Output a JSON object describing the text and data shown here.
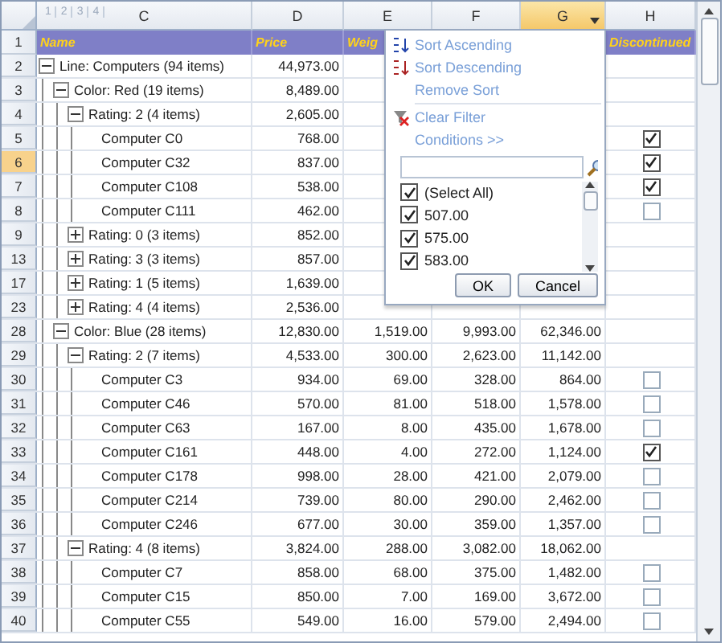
{
  "outline_levels": [
    "1",
    "2",
    "3",
    "4"
  ],
  "columns": [
    {
      "letter": "C",
      "selected": false
    },
    {
      "letter": "D",
      "selected": false
    },
    {
      "letter": "E",
      "selected": false
    },
    {
      "letter": "F",
      "selected": false
    },
    {
      "letter": "G",
      "selected": true
    },
    {
      "letter": "H",
      "selected": false
    }
  ],
  "header_row": {
    "number": "1",
    "name": "Name",
    "price": "Price",
    "weight": "Weig",
    "discontinued": "Discontinued"
  },
  "rows": [
    {
      "number": "2",
      "name": "Line: Computers (94 items)",
      "expanded": true,
      "selected": false,
      "price": "44,973.00",
      "children": [
        {
          "number": "3",
          "name": "Color: Red (19 items)",
          "expanded": true,
          "selected": false,
          "price": "8,489.00",
          "children": [
            {
              "number": "4",
              "name": "Rating: 2 (4 items)",
              "expanded": true,
              "selected": false,
              "price": "2,605.00",
              "children": [
                {
                  "number": "5",
                  "name": "Computer C0",
                  "selected": false,
                  "price": "768.00",
                  "discontinued": true
                },
                {
                  "number": "6",
                  "name": "Computer C32",
                  "selected": true,
                  "price": "837.00",
                  "discontinued": true
                },
                {
                  "number": "7",
                  "name": "Computer C108",
                  "selected": false,
                  "price": "538.00",
                  "discontinued": true
                },
                {
                  "number": "8",
                  "name": "Computer C111",
                  "selected": false,
                  "price": "462.00",
                  "discontinued": false
                }
              ]
            },
            {
              "number": "9",
              "name": "Rating: 0 (3 items)",
              "expanded": false,
              "selected": false,
              "price": "852.00"
            },
            {
              "number": "13",
              "name": "Rating: 3 (3 items)",
              "expanded": false,
              "selected": false,
              "price": "857.00"
            },
            {
              "number": "17",
              "name": "Rating: 1 (5 items)",
              "expanded": false,
              "selected": false,
              "price": "1,639.00"
            },
            {
              "number": "23",
              "name": "Rating: 4 (4 items)",
              "expanded": false,
              "selected": false,
              "price": "2,536.00"
            }
          ]
        },
        {
          "number": "28",
          "name": "Color: Blue (28 items)",
          "expanded": true,
          "selected": false,
          "price": "12,830.00",
          "weight": "1,519.00",
          "f": "9,993.00",
          "g": "62,346.00",
          "children": [
            {
              "number": "29",
              "name": "Rating: 2 (7 items)",
              "expanded": true,
              "selected": false,
              "price": "4,533.00",
              "weight": "300.00",
              "f": "2,623.00",
              "g": "11,142.00",
              "children": [
                {
                  "number": "30",
                  "name": "Computer C3",
                  "selected": false,
                  "price": "934.00",
                  "weight": "69.00",
                  "f": "328.00",
                  "g": "864.00",
                  "discontinued": false
                },
                {
                  "number": "31",
                  "name": "Computer C46",
                  "selected": false,
                  "price": "570.00",
                  "weight": "81.00",
                  "f": "518.00",
                  "g": "1,578.00",
                  "discontinued": false
                },
                {
                  "number": "32",
                  "name": "Computer C63",
                  "selected": false,
                  "price": "167.00",
                  "weight": "8.00",
                  "f": "435.00",
                  "g": "1,678.00",
                  "discontinued": false
                },
                {
                  "number": "33",
                  "name": "Computer C161",
                  "selected": false,
                  "price": "448.00",
                  "weight": "4.00",
                  "f": "272.00",
                  "g": "1,124.00",
                  "discontinued": true
                },
                {
                  "number": "34",
                  "name": "Computer C178",
                  "selected": false,
                  "price": "998.00",
                  "weight": "28.00",
                  "f": "421.00",
                  "g": "2,079.00",
                  "discontinued": false
                },
                {
                  "number": "35",
                  "name": "Computer C214",
                  "selected": false,
                  "price": "739.00",
                  "weight": "80.00",
                  "f": "290.00",
                  "g": "2,462.00",
                  "discontinued": false
                },
                {
                  "number": "36",
                  "name": "Computer C246",
                  "selected": false,
                  "price": "677.00",
                  "weight": "30.00",
                  "f": "359.00",
                  "g": "1,357.00",
                  "discontinued": false
                }
              ]
            },
            {
              "number": "37",
              "name": "Rating: 4 (8 items)",
              "expanded": true,
              "selected": false,
              "price": "3,824.00",
              "weight": "288.00",
              "f": "3,082.00",
              "g": "18,062.00",
              "children": [
                {
                  "number": "38",
                  "name": "Computer C7",
                  "selected": false,
                  "price": "858.00",
                  "weight": "68.00",
                  "f": "375.00",
                  "g": "1,482.00",
                  "discontinued": false
                },
                {
                  "number": "39",
                  "name": "Computer C15",
                  "selected": false,
                  "price": "850.00",
                  "weight": "7.00",
                  "f": "169.00",
                  "g": "3,672.00",
                  "discontinued": false
                },
                {
                  "number": "40",
                  "name": "Computer C55",
                  "selected": false,
                  "price": "549.00",
                  "weight": "16.00",
                  "f": "579.00",
                  "g": "2,494.00",
                  "discontinued": false
                }
              ]
            }
          ]
        }
      ]
    }
  ],
  "filter_menu": {
    "actions": [
      {
        "label": "Sort Ascending",
        "kind": "sort-asc"
      },
      {
        "label": "Sort Descending",
        "kind": "sort-desc"
      },
      {
        "label": "Remove Sort",
        "kind": "plain"
      },
      {
        "label": "Clear Filter",
        "kind": "clear"
      },
      {
        "label": "Conditions >>",
        "kind": "plain"
      }
    ],
    "values": [
      {
        "label": "(Select All)",
        "checked": true
      },
      {
        "label": "507.00",
        "checked": true
      },
      {
        "label": "575.00",
        "checked": true
      },
      {
        "label": "583.00",
        "checked": true
      }
    ],
    "buttons": [
      "OK",
      "Cancel"
    ]
  }
}
